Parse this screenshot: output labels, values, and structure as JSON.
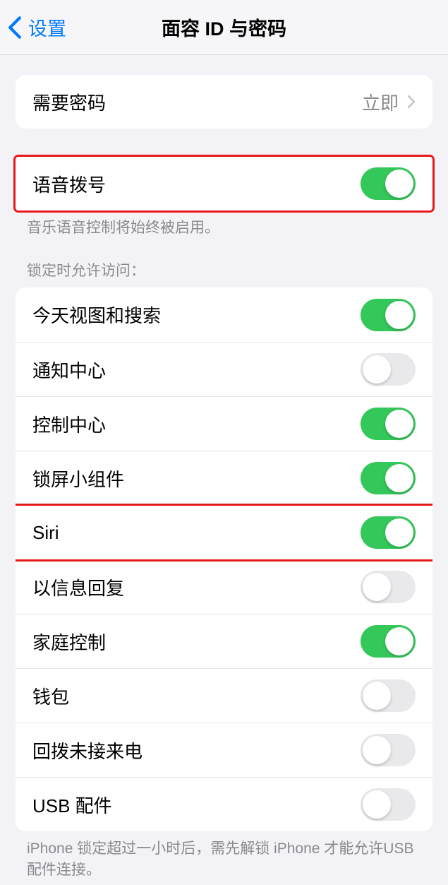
{
  "header": {
    "back_label": "设置",
    "title": "面容 ID 与密码"
  },
  "require_passcode": {
    "label": "需要密码",
    "value": "立即"
  },
  "voice_dial": {
    "label": "语音拨号",
    "on": true,
    "footer": "音乐语音控制将始终被启用。"
  },
  "lock_access": {
    "header": "锁定时允许访问：",
    "items": [
      {
        "label": "今天视图和搜索",
        "on": true
      },
      {
        "label": "通知中心",
        "on": false
      },
      {
        "label": "控制中心",
        "on": true
      },
      {
        "label": "锁屏小组件",
        "on": true
      },
      {
        "label": "Siri",
        "on": true,
        "highlighted": true
      },
      {
        "label": "以信息回复",
        "on": false
      },
      {
        "label": "家庭控制",
        "on": true
      },
      {
        "label": "钱包",
        "on": false
      },
      {
        "label": "回拨未接来电",
        "on": false
      },
      {
        "label": "USB 配件",
        "on": false
      }
    ],
    "footer": "iPhone 锁定超过一小时后，需先解锁 iPhone 才能允许USB 配件连接。"
  }
}
